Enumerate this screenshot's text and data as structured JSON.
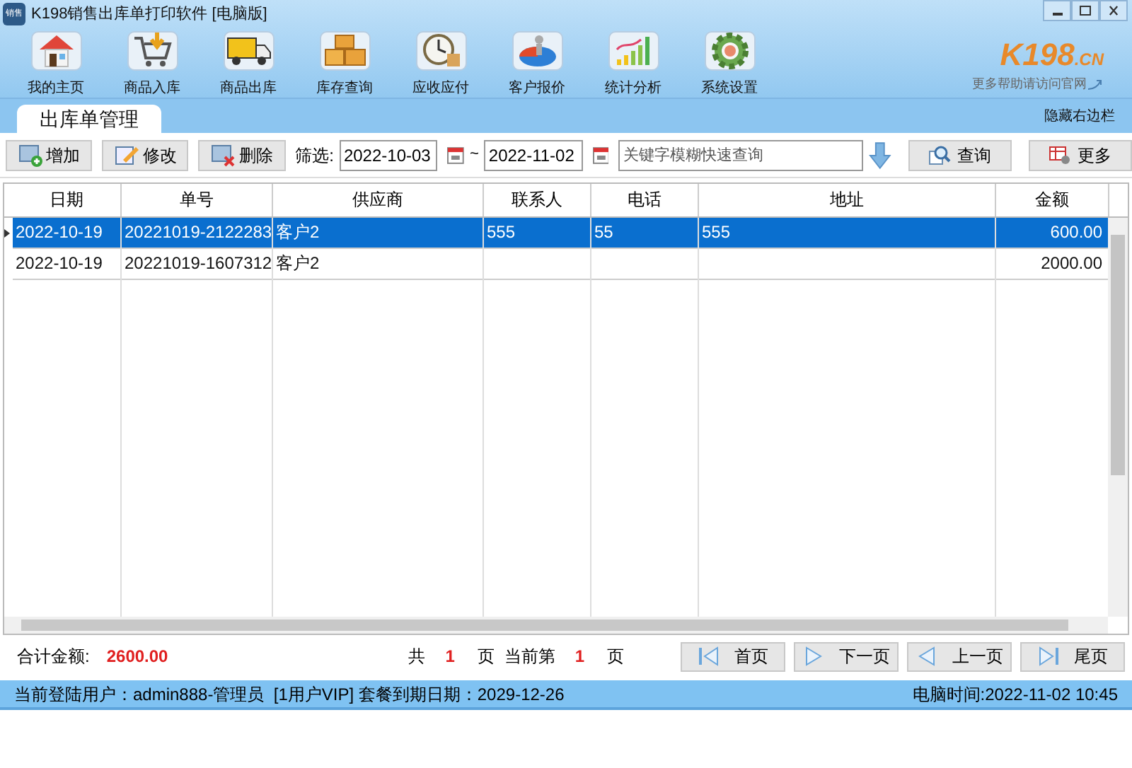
{
  "window": {
    "title": "K198销售出库单打印软件 [电脑版]",
    "app_badge": "销售"
  },
  "nav": [
    {
      "label": "我的主页"
    },
    {
      "label": "商品入库"
    },
    {
      "label": "商品出库"
    },
    {
      "label": "库存查询"
    },
    {
      "label": "应收应付"
    },
    {
      "label": "客户报价"
    },
    {
      "label": "统计分析"
    },
    {
      "label": "系统设置"
    }
  ],
  "logo": {
    "text": "K198",
    "suffix": ".CN",
    "tagline": "更多帮助请访问官网"
  },
  "tabs": [
    {
      "label": "出库单管理",
      "selected": true
    }
  ],
  "hide_sidebar": "隐藏右边栏",
  "toolbar": {
    "buttons": [
      {
        "label": "增加"
      },
      {
        "label": "修改"
      },
      {
        "label": "删除"
      }
    ],
    "filter_label": "筛选:",
    "date_from": "2022-10-03",
    "range_separator": "~",
    "date_to": "2022-11-02",
    "search": {
      "placeholder": "关键字模糊快速查询"
    },
    "query_button": "查询",
    "more_button": "更多"
  },
  "table": {
    "columns": [
      "日期",
      "单号",
      "供应商",
      "联系人",
      "电话",
      "地址",
      "金额"
    ],
    "rows": [
      {
        "selected": true,
        "cells": [
          "2022-10-19",
          "20221019-2122283",
          "客户2",
          "555",
          "55",
          "555",
          "600.00"
        ]
      },
      {
        "selected": false,
        "cells": [
          "2022-10-19",
          "20221019-1607312",
          "客户2",
          "",
          "",
          "",
          "2000.00"
        ]
      }
    ]
  },
  "footer": {
    "total_label": "合计金额:",
    "total_value": "2600.00",
    "pages_prefix": "共",
    "page_count": "1",
    "pages_unit": "页",
    "current_prefix": "当前第",
    "current_page": "1",
    "current_unit": "页",
    "nav_buttons": [
      "首页",
      "下一页",
      "上一页",
      "尾页"
    ]
  },
  "status_bar": {
    "user": "当前登陆用户：admin888-管理员  [1用户VIP] 套餐到期日期：2029-12-26",
    "clock": "电脑时间:2022-11-02 10:45"
  }
}
